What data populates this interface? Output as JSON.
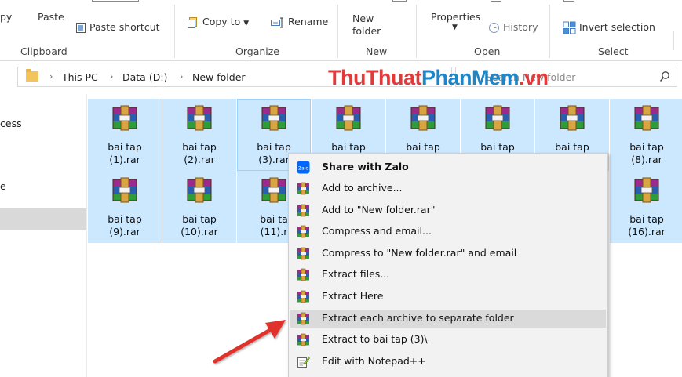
{
  "ribbon": {
    "copy_label": "py",
    "paste_label": "Paste",
    "paste_shortcut": "Paste shortcut",
    "copy_to": "Copy to",
    "rename": "Rename",
    "new_folder_line1": "New",
    "new_folder_line2": "folder",
    "properties": "Properties",
    "history": "History",
    "invert_selection": "Invert selection",
    "groups": {
      "clipboard": "Clipboard",
      "organize": "Organize",
      "new": "New",
      "open": "Open",
      "select": "Select"
    }
  },
  "address": {
    "crumbs": [
      "This PC",
      "Data (D:)",
      "New folder"
    ],
    "search_placeholder": "Search New folder"
  },
  "watermark": {
    "part1": "ThuThuat",
    "part2": "PhanMem",
    "part3": ".vn"
  },
  "nav": {
    "access": "cess",
    "e": "e"
  },
  "files": [
    {
      "line1": "bai tap",
      "line2": "(1).rar"
    },
    {
      "line1": "bai tap",
      "line2": "(2).rar"
    },
    {
      "line1": "bai tap",
      "line2": "(3).rar"
    },
    {
      "line1": "bai tap",
      "line2": ""
    },
    {
      "line1": "bai tap",
      "line2": ""
    },
    {
      "line1": "bai tap",
      "line2": ""
    },
    {
      "line1": "bai tap",
      "line2": ""
    },
    {
      "line1": "bai tap",
      "line2": "(8).rar"
    },
    {
      "line1": "bai tap",
      "line2": "(9).rar"
    },
    {
      "line1": "bai tap",
      "line2": "(10).rar"
    },
    {
      "line1": "bai ta",
      "line2": "(11).r"
    },
    {
      "line1": "bai tap",
      "line2": "(16).rar"
    }
  ],
  "menu": {
    "items": [
      {
        "label": "Share with Zalo",
        "icon": "zalo-icon"
      },
      {
        "label": "Add to archive...",
        "icon": "winrar-icon"
      },
      {
        "label": "Add to \"New folder.rar\"",
        "icon": "winrar-icon"
      },
      {
        "label": "Compress and email...",
        "icon": "winrar-icon"
      },
      {
        "label": "Compress to \"New folder.rar\" and email",
        "icon": "winrar-icon"
      },
      {
        "label": "Extract files...",
        "icon": "winrar-icon"
      },
      {
        "label": "Extract Here",
        "icon": "winrar-icon"
      },
      {
        "label": "Extract each archive to separate folder",
        "icon": "winrar-icon"
      },
      {
        "label": "Extract to bai tap (3)\\",
        "icon": "winrar-icon"
      },
      {
        "label": "Edit with Notepad++",
        "icon": "notepad-plus-plus-icon"
      }
    ]
  },
  "colors": {
    "selection": "#cce8ff",
    "menu_bg": "#f2f2f2",
    "menu_highlight": "#dadada",
    "arrow": "#e0312b",
    "watermark_red": "#e23a3a",
    "watermark_blue": "#1d86c8"
  }
}
